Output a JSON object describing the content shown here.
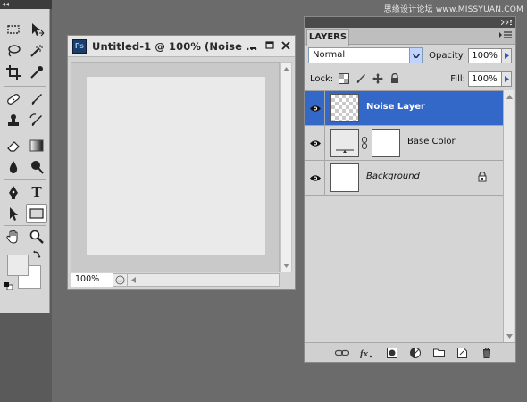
{
  "watermark": "思缘设计论坛 www.MISSYUAN.COM",
  "toolbox": {
    "collapse_glyph": "◂◂",
    "tools": [
      {
        "name": "marquee-tool-icon"
      },
      {
        "name": "move-tool-icon"
      },
      {
        "name": "lasso-tool-icon"
      },
      {
        "name": "magic-wand-tool-icon"
      },
      {
        "name": "crop-tool-icon"
      },
      {
        "name": "eyedropper-tool-icon"
      },
      {
        "name": "healing-brush-tool-icon"
      },
      {
        "name": "brush-tool-icon"
      },
      {
        "name": "clone-stamp-tool-icon"
      },
      {
        "name": "history-brush-tool-icon"
      },
      {
        "name": "eraser-tool-icon"
      },
      {
        "name": "gradient-tool-icon"
      },
      {
        "name": "blur-tool-icon"
      },
      {
        "name": "dodge-tool-icon"
      },
      {
        "name": "pen-tool-icon"
      },
      {
        "name": "type-tool-icon"
      },
      {
        "name": "path-selection-tool-icon"
      },
      {
        "name": "rectangle-tool-icon"
      },
      {
        "name": "hand-tool-icon"
      },
      {
        "name": "zoom-tool-icon"
      }
    ],
    "type_glyph": "T",
    "foreground_color": "#ebebeb",
    "background_color": "#ffffff"
  },
  "document": {
    "ps_badge": "Ps",
    "title": "Untitled-1 @ 100% (Noise ...",
    "zoom": "100%",
    "canvas_color": "#eaeaea"
  },
  "layers_panel": {
    "tab_label": "LAYERS",
    "blend_mode": "Normal",
    "opacity_label": "Opacity:",
    "opacity_value": "100%",
    "lock_label": "Lock:",
    "fill_label": "Fill:",
    "fill_value": "100%",
    "layers": [
      {
        "name": "Noise Layer",
        "selected": true,
        "thumb": "transparent"
      },
      {
        "name": "Base Color",
        "selected": false,
        "thumb": "fill-with-mask"
      },
      {
        "name": "Background",
        "selected": false,
        "thumb": "white",
        "locked": true
      }
    ],
    "selection_color": "#3468c8"
  }
}
